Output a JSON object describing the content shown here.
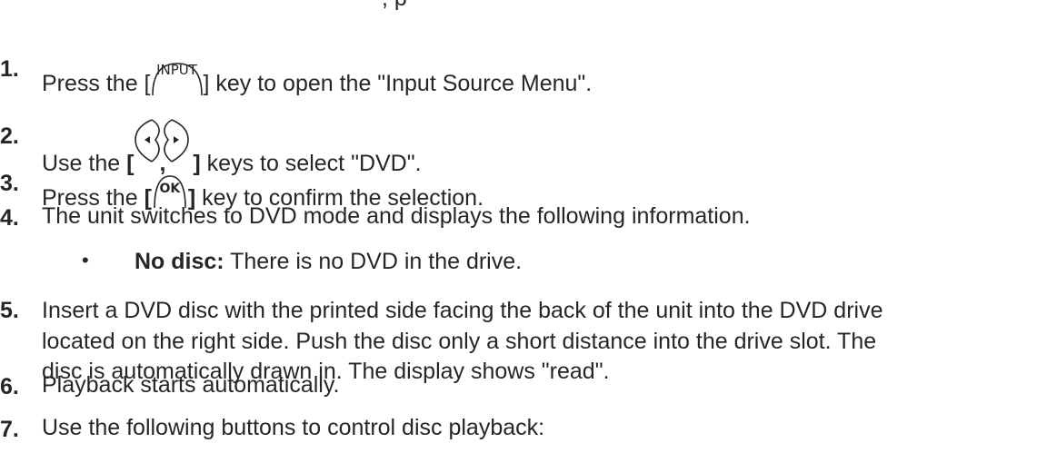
{
  "header_fragment": ", p",
  "steps": [
    {
      "number": "1.",
      "before": "Press the [",
      "key": "INPUT",
      "after": "] key to open the \"Input Source Menu\"."
    },
    {
      "number": "2.",
      "before": "Use the ",
      "open_bracket": "[",
      "comma": ",",
      "close_bracket": "]",
      "after": " keys to select \"DVD\".",
      "key_icons": [
        "left-arrow-key-icon",
        "right-arrow-key-icon"
      ]
    },
    {
      "number": "3.",
      "before": "Press the ",
      "open_bracket": "[",
      "key": "OK",
      "close_bracket": "]",
      "after": " key to confirm the selection."
    },
    {
      "number": "4.",
      "text": "The unit switches to DVD mode and displays the following information."
    },
    {
      "number": "5.",
      "lines": [
        "Insert a DVD disc with the printed side facing the back of the unit into the DVD drive",
        "located on the right side. Push the disc only a short distance into the drive slot. The",
        "disc is automatically drawn in. The display shows \"read\"."
      ]
    },
    {
      "number": "6.",
      "text": "Playback starts automatically."
    },
    {
      "number": "7.",
      "text": "Use the following buttons to control disc playback:"
    }
  ],
  "bullet": {
    "symbol": "•",
    "label": "No disc:",
    "text": " There is no DVD in the drive."
  }
}
